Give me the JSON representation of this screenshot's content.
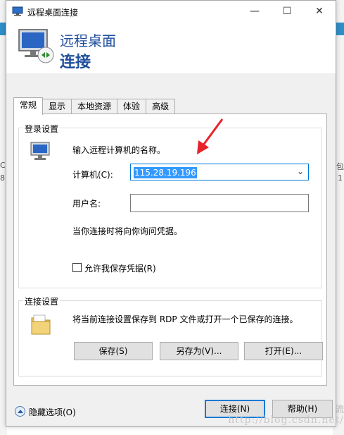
{
  "window": {
    "title": "远程桌面连接",
    "controls": {
      "minimize": "—",
      "maximize": "☐",
      "close": "✕"
    }
  },
  "header": {
    "line1": "远程桌面",
    "line2": "连接"
  },
  "tabs": [
    {
      "label": "常规",
      "active": true
    },
    {
      "label": "显示"
    },
    {
      "label": "本地资源"
    },
    {
      "label": "体验"
    },
    {
      "label": "高级"
    }
  ],
  "login": {
    "group_title": "登录设置",
    "instruction": "输入远程计算机的名称。",
    "computer_label": "计算机(C):",
    "computer_value": "115.28.19.196",
    "username_label": "用户名:",
    "username_value": "",
    "credential_note": "当你连接时将向你询问凭据。",
    "save_credentials_label": "允许我保存凭据(R)",
    "save_credentials_checked": false
  },
  "connection": {
    "group_title": "连接设置",
    "description": "将当前连接设置保存到 RDP 文件或打开一个已保存的连接。",
    "save_button": "保存(S)",
    "save_as_button": "另存为(V)...",
    "open_button": "打开(E)..."
  },
  "footer": {
    "hide_options": "隐藏选项(O)",
    "connect_button": "连接(N)",
    "help_button": "帮助(H)"
  },
  "background": {
    "left_marks": [
      "C",
      "8"
    ],
    "right_marks": [
      "包",
      "1"
    ],
    "watermark": "http://blog.csdn.net/",
    "watermark_cn": "流"
  },
  "colors": {
    "accent": "#0078d7",
    "header_text": "#1f4e9c",
    "selection": "#3399ff",
    "annotation_arrow": "#e8222a"
  }
}
